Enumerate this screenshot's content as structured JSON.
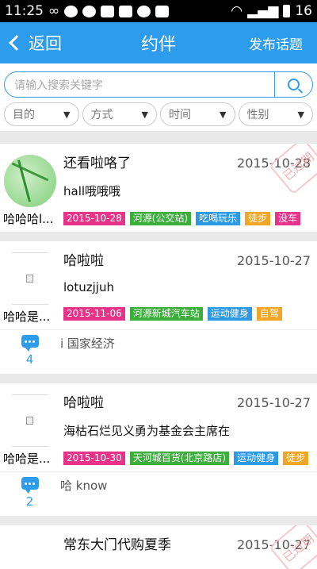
{
  "status_bar": {
    "time": "11:25",
    "battery": "16"
  },
  "header": {
    "back_label": "返回",
    "title": "约伴",
    "publish_label": "发布话题"
  },
  "search": {
    "placeholder": "请输入搜索关键字"
  },
  "filters": [
    "目的",
    "方式",
    "时间",
    "性别"
  ],
  "stamp_text": "已过期",
  "posts": [
    {
      "user": "哈哈哈l...",
      "title": "还看啦咯了",
      "date": "2015-10-28",
      "desc": "hall哦哦哦",
      "tags": [
        {
          "text": "2015-10-28",
          "kind": "date"
        },
        {
          "text": "河源(公交站)",
          "kind": "place"
        },
        {
          "text": "吃喝玩乐",
          "kind": "act"
        },
        {
          "text": "徒步",
          "kind": "way"
        },
        {
          "text": "没车",
          "kind": "date"
        }
      ]
    },
    {
      "user": "哈哈是...",
      "title": "哈啦啦",
      "date": "2015-10-27",
      "desc": "lotuzjjuh",
      "tags": [
        {
          "text": "2015-11-06",
          "kind": "date"
        },
        {
          "text": "河源新城汽车站",
          "kind": "place"
        },
        {
          "text": "运动健身",
          "kind": "act"
        },
        {
          "text": "自驾",
          "kind": "way"
        }
      ],
      "comment_count": "4",
      "comment": "i 国家经济"
    },
    {
      "user": "哈哈是...",
      "title": "哈啦啦",
      "date": "2015-10-27",
      "desc": "海枯石烂见义勇为基金会主席在",
      "tags": [
        {
          "text": "2015-10-30",
          "kind": "date"
        },
        {
          "text": "天河城百货(北京路店)",
          "kind": "place"
        },
        {
          "text": "运动健身",
          "kind": "act"
        },
        {
          "text": "徒步",
          "kind": "way"
        }
      ],
      "comment_count": "2",
      "comment": "哈 know"
    },
    {
      "title": "常东大门代购夏季",
      "date": "2015-10-27"
    }
  ]
}
